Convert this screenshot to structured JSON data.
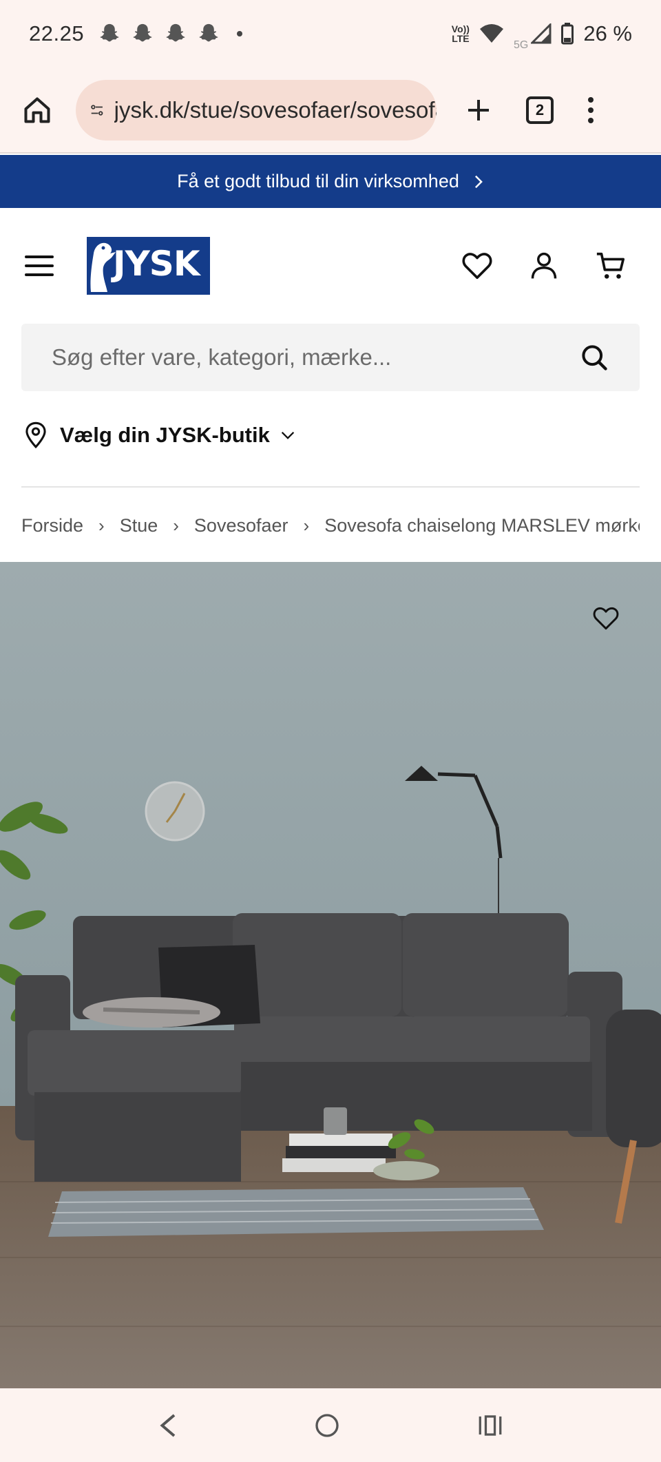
{
  "status_bar": {
    "time": "22.25",
    "network": "5G",
    "volte_top": "Vo))",
    "volte_bottom": "LTE",
    "battery": "26 %"
  },
  "browser": {
    "url": "jysk.dk/stue/sovesofaer/sovesofa-chaiselong-marslev",
    "tab_count": "2"
  },
  "promo": {
    "text": "Få et godt tilbud til din virksomhed"
  },
  "header": {
    "logo_text": "JYSK"
  },
  "search": {
    "placeholder": "Søg efter vare, kategori, mærke..."
  },
  "store": {
    "label": "Vælg din JYSK-butik"
  },
  "breadcrumb": {
    "items": [
      "Forside",
      "Stue",
      "Sovesofaer",
      "Sovesofa chaiselong MARSLEV mørkegrå"
    ]
  },
  "colors": {
    "brand_blue": "#143c8a",
    "browser_bg": "#fdf3f0",
    "url_pill": "#f6ddd4"
  }
}
